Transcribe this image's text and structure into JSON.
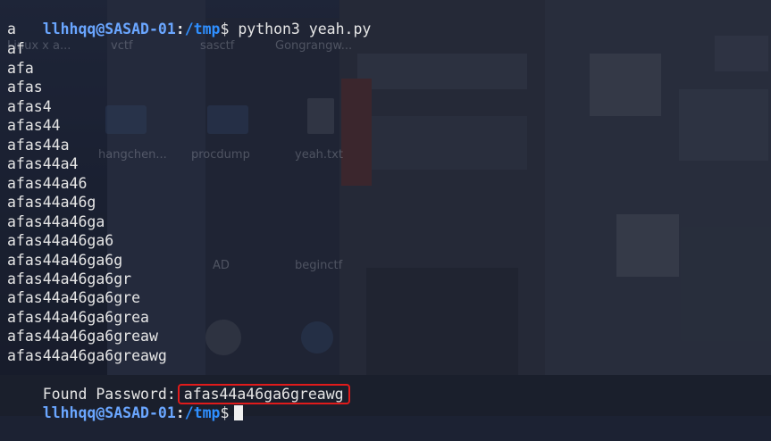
{
  "terminal": {
    "prompt": {
      "user_host": "llhhqq@SASAD-01",
      "colon": ":",
      "path": "/tmp",
      "dollar": "$"
    },
    "command": "python3 yeah.py",
    "output_lines": [
      "a",
      "af",
      "afa",
      "afas",
      "afas4",
      "afas44",
      "afas44a",
      "afas44a4",
      "afas44a46",
      "afas44a46g",
      "afas44a46ga",
      "afas44a46ga6",
      "afas44a46ga6g",
      "afas44a46ga6gr",
      "afas44a46ga6gre",
      "afas44a46ga6grea",
      "afas44a46ga6greaw",
      "afas44a46ga6greawg"
    ],
    "found_label": "Found Password:",
    "found_value": "afas44a46ga6greawg"
  },
  "desktop_icons": [
    "Linux x a...",
    "vctf",
    "sasctf",
    "Gongrangw...",
    "hangchen...",
    "procdump",
    "yeah.txt",
    "AD",
    "beginctf"
  ],
  "colors": {
    "prompt_user": "#6aa6ff",
    "prompt_path": "#2f8fff",
    "text": "#e6e6e6",
    "highlight_border": "#e01b1b"
  }
}
